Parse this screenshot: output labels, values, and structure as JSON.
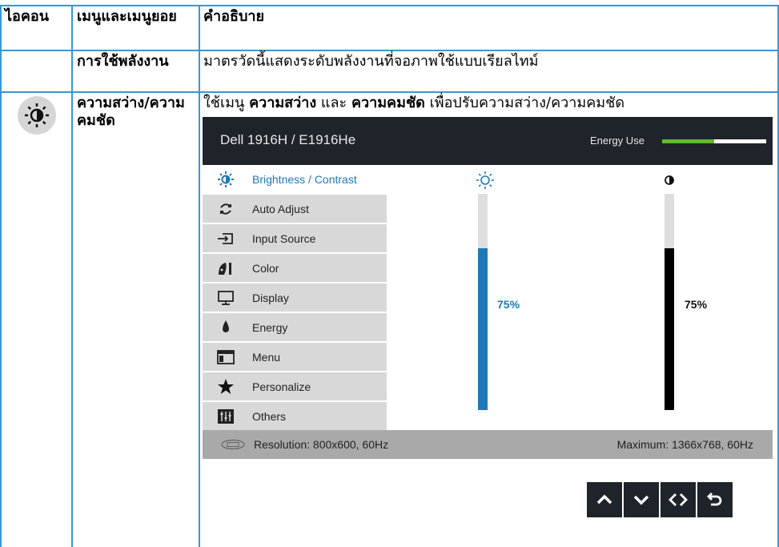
{
  "table": {
    "headers": {
      "icon": "ไอคอน",
      "menu": "เมนูและเมนูยอย",
      "description": "คำอธิบาย"
    },
    "rows": [
      {
        "menu": "การใช้พลังงาน",
        "description": "มาตรวัดนี้แสดงระดับพลังงานที่จอภาพใช้แบบเรียลไทม์"
      },
      {
        "icon": "brightness-icon",
        "menu": "ความสว่าง/ความคมชัด",
        "description": {
          "prefix": "ใช้เมนู ",
          "bold1": "ความสว่าง",
          "middle": " และ ",
          "bold2": "ความคมชัด",
          "suffix": " เพื่อปรับความสว่าง/ความคมชัด"
        }
      }
    ]
  },
  "osd": {
    "model": "Dell 1916H / E1916He",
    "energy_label": "Energy Use",
    "energy_level": 0.5,
    "colors": {
      "accent": "#1d79b8",
      "energy": "#5fb82d",
      "header_bg": "#1e2429"
    },
    "menu_items": [
      {
        "label": "Brightness / Contrast",
        "icon": "brightness-icon",
        "active": true
      },
      {
        "label": "Auto Adjust",
        "icon": "auto-adjust-icon"
      },
      {
        "label": "Input Source",
        "icon": "input-source-icon"
      },
      {
        "label": "Color",
        "icon": "color-icon"
      },
      {
        "label": "Display",
        "icon": "display-icon"
      },
      {
        "label": "Energy",
        "icon": "energy-icon"
      },
      {
        "label": "Menu",
        "icon": "menu-icon"
      },
      {
        "label": "Personalize",
        "icon": "star-icon"
      },
      {
        "label": "Others",
        "icon": "others-icon"
      }
    ],
    "brightness": {
      "icon": "sun-icon",
      "value": 75,
      "label": "75%"
    },
    "contrast": {
      "icon": "contrast-icon",
      "value": 75,
      "label": "75%"
    },
    "resolution": "Resolution: 800x600, 60Hz",
    "maximum": "Maximum: 1366x768, 60Hz",
    "nav_buttons": [
      "up-arrow-icon",
      "down-arrow-icon",
      "left-right-icon",
      "back-icon"
    ]
  }
}
